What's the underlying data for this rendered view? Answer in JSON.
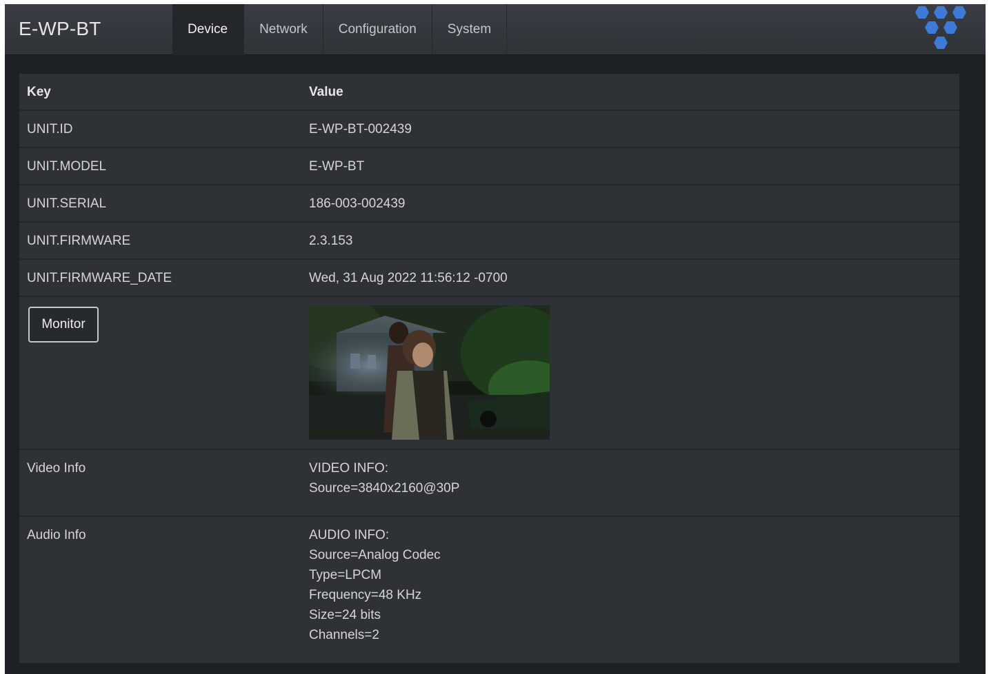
{
  "app": {
    "title": "E-WP-BT"
  },
  "nav": {
    "tabs": [
      {
        "label": "Device",
        "active": true
      },
      {
        "label": "Network",
        "active": false
      },
      {
        "label": "Configuration",
        "active": false
      },
      {
        "label": "System",
        "active": false
      }
    ],
    "logo_icon": "hexagon-cluster-logo",
    "logo_color": "#3d7bd6"
  },
  "table": {
    "headers": {
      "key": "Key",
      "value": "Value"
    },
    "rows": [
      {
        "key": "UNIT.ID",
        "value": "E-WP-BT-002439"
      },
      {
        "key": "UNIT.MODEL",
        "value": "E-WP-BT"
      },
      {
        "key": "UNIT.SERIAL",
        "value": "186-003-002439"
      },
      {
        "key": "UNIT.FIRMWARE",
        "value": "2.3.153"
      },
      {
        "key": "UNIT.FIRMWARE_DATE",
        "value": "Wed, 31 Aug 2022 11:56:12 -0700"
      }
    ],
    "monitor": {
      "button_label": "Monitor",
      "preview_icon": "video-preview-thumbnail"
    },
    "video_info": {
      "key": "Video Info",
      "lines": [
        "VIDEO INFO:",
        "Source=3840x2160@30P"
      ]
    },
    "audio_info": {
      "key": "Audio Info",
      "lines": [
        "AUDIO INFO:",
        "Source=Analog Codec",
        "Type=LPCM",
        "Frequency=48 KHz",
        "Size=24 bits",
        "Channels=2"
      ]
    }
  }
}
